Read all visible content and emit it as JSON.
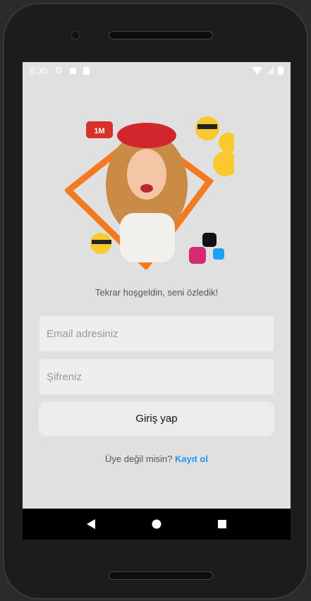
{
  "status_bar": {
    "time": "6:30"
  },
  "illustration": {
    "badge_text": "1M"
  },
  "welcome_text": "Tekrar hoşgeldin, seni özledik!",
  "email": {
    "placeholder": "Email adresiniz",
    "value": ""
  },
  "password": {
    "placeholder": "Şifreniz",
    "value": ""
  },
  "login_button": "Giriş yap",
  "signup": {
    "prompt": "Üye değil misin?",
    "link": "Kayıt ol"
  },
  "colors": {
    "accent": "#2196f3",
    "background": "#e0e0e0",
    "field": "#eeeeee"
  }
}
